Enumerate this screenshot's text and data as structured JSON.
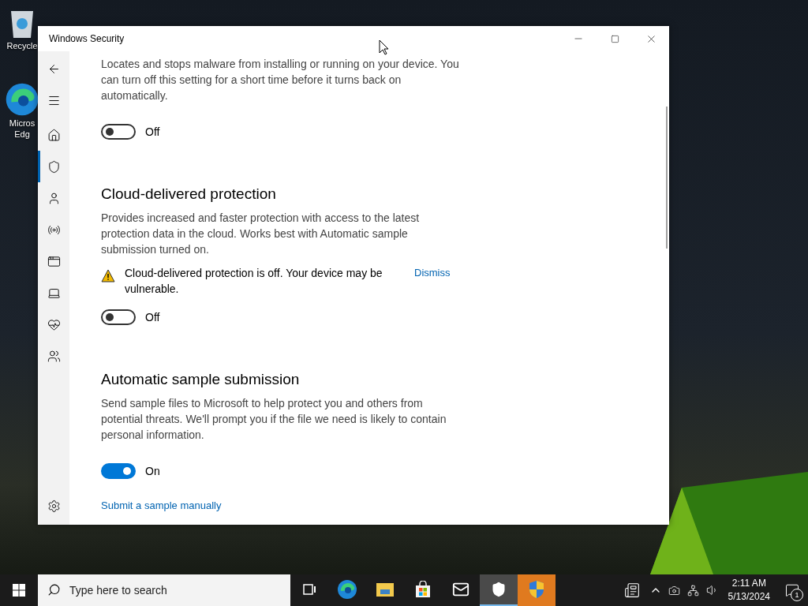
{
  "desktop_icons": [
    {
      "label": "Recycle",
      "kind": "recycle"
    },
    {
      "label": "Micros",
      "kind": "edge"
    },
    {
      "label": "Edg",
      "kind": "label"
    }
  ],
  "window": {
    "title": "Windows Security"
  },
  "nav": [
    {
      "kind": "back",
      "selected": false
    },
    {
      "kind": "menu",
      "selected": false
    },
    {
      "kind": "home",
      "selected": false
    },
    {
      "kind": "shield",
      "selected": true
    },
    {
      "kind": "account",
      "selected": false
    },
    {
      "kind": "network",
      "selected": false
    },
    {
      "kind": "app",
      "selected": false
    },
    {
      "kind": "device",
      "selected": false
    },
    {
      "kind": "health",
      "selected": false
    },
    {
      "kind": "family",
      "selected": false
    }
  ],
  "sections": [
    {
      "description": "Locates and stops malware from installing or running on your device. You can turn off this setting for a short time before it turns back on automatically.",
      "toggle": {
        "on": false,
        "label": "Off"
      }
    },
    {
      "title": "Cloud-delivered protection",
      "description": "Provides increased and faster protection with access to the latest protection data in the cloud. Works best with Automatic sample submission turned on.",
      "warning": {
        "text": "Cloud-delivered protection is off. Your device may be vulnerable.",
        "action": "Dismiss"
      },
      "toggle": {
        "on": false,
        "label": "Off"
      }
    },
    {
      "title": "Automatic sample submission",
      "description": "Send sample files to Microsoft to help protect you and others from potential threats. We'll prompt you if the file we need is likely to contain personal information.",
      "toggle": {
        "on": true,
        "label": "On"
      },
      "link": "Submit a sample manually"
    }
  ],
  "taskbar": {
    "search": {
      "placeholder": "Type here to search"
    },
    "apps": [
      {
        "kind": "taskview",
        "selected": false,
        "attention": false
      },
      {
        "kind": "edge",
        "selected": false,
        "attention": false
      },
      {
        "kind": "explorer",
        "selected": false,
        "attention": false
      },
      {
        "kind": "store",
        "selected": false,
        "attention": false
      },
      {
        "kind": "mail",
        "selected": false,
        "attention": false
      },
      {
        "kind": "security",
        "selected": true,
        "attention": false
      },
      {
        "kind": "uac",
        "selected": false,
        "attention": true
      }
    ],
    "time": "2:11 AM",
    "date": "5/13/2024",
    "notifications": "1"
  }
}
